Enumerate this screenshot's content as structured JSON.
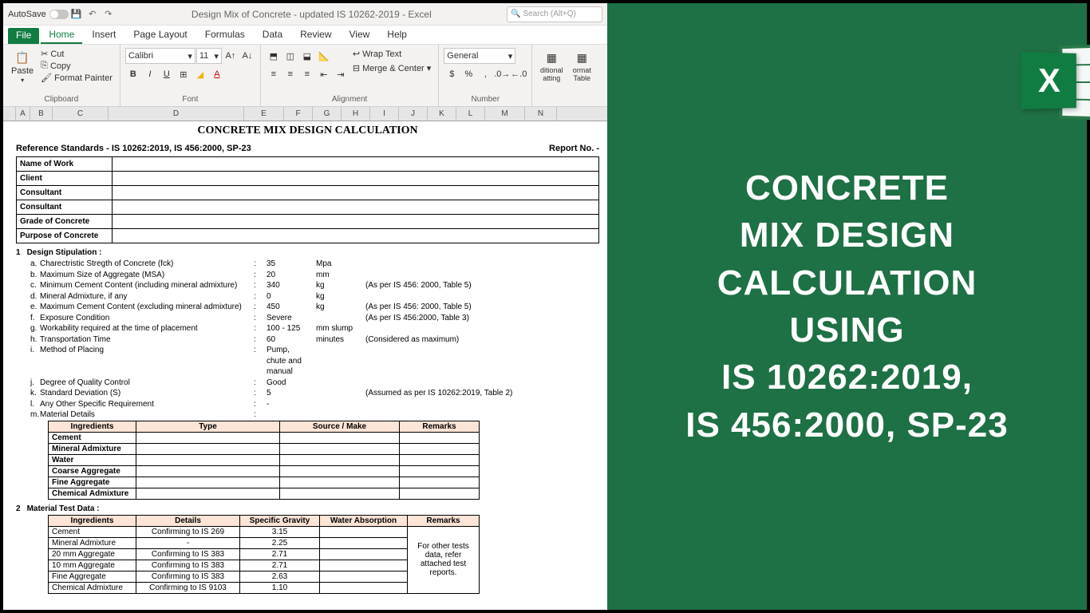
{
  "titlebar": {
    "autosave": "AutoSave",
    "title": "Design Mix of Concrete - updated IS 10262-2019  -  Excel",
    "search_placeholder": "Search (Alt+Q)"
  },
  "tabs": {
    "file": "File",
    "home": "Home",
    "insert": "Insert",
    "pagelayout": "Page Layout",
    "formulas": "Formulas",
    "data": "Data",
    "review": "Review",
    "view": "View",
    "help": "Help"
  },
  "ribbon": {
    "clipboard": {
      "label": "Clipboard",
      "paste": "Paste",
      "cut": "Cut",
      "copy": "Copy",
      "fmtpainter": "Format Painter"
    },
    "font": {
      "label": "Font",
      "name": "Calibri",
      "size": "11"
    },
    "alignment": {
      "label": "Alignment",
      "wrap": "Wrap Text",
      "merge": "Merge & Center"
    },
    "number": {
      "label": "Number",
      "format": "General"
    },
    "styles": {
      "cond": "ditional atting",
      "table": "ormat Table"
    }
  },
  "cols": [
    "A",
    "B",
    "C",
    "D",
    "E",
    "F",
    "G",
    "H",
    "I",
    "J",
    "K",
    "L",
    "M",
    "N"
  ],
  "doc": {
    "title": "CONCRETE MIX DESIGN CALCULATION",
    "ref": "Reference Standards - IS 10262:2019, IS 456:2000, SP-23",
    "report": "Report No. -",
    "header_rows": [
      "Name of Work",
      "Client",
      "Consultant",
      "Consultant",
      "Grade of Concrete",
      "Purpose of Concrete"
    ],
    "sec1_num": "1",
    "sec1": "Design Stipulation :",
    "stips": [
      {
        "l": "a.",
        "t": "Charectristic Stregth of Concrete (fck)",
        "v": "35",
        "u": "Mpa",
        "n": ""
      },
      {
        "l": "b.",
        "t": "Maximum Size of Aggregate (MSA)",
        "v": "20",
        "u": "mm",
        "n": ""
      },
      {
        "l": "c.",
        "t": "Minimum Cement Content (including mineral admixture)",
        "v": "340",
        "u": "kg",
        "n": "(As per IS 456: 2000, Table 5)"
      },
      {
        "l": "d.",
        "t": "Mineral Admixture, if any",
        "v": "0",
        "u": "kg",
        "n": ""
      },
      {
        "l": "e.",
        "t": "Maximum Cement Content (excluding mineral admixture)",
        "v": "450",
        "u": "kg",
        "n": "(As per IS 456: 2000, Table 5)"
      },
      {
        "l": "f.",
        "t": "Exposure Condition",
        "v": "Severe",
        "u": "",
        "n": "(As per IS 456:2000, Table 3)"
      },
      {
        "l": "g.",
        "t": "Workability required at the time of placement",
        "v": "100 - 125",
        "u": "mm slump",
        "n": ""
      },
      {
        "l": "h.",
        "t": "Transportation Time",
        "v": "60",
        "u": "minutes",
        "n": "(Considered as maximum)"
      },
      {
        "l": "i.",
        "t": "Method of Placing",
        "v": "Pump, chute and manual",
        "u": "",
        "n": ""
      },
      {
        "l": "j.",
        "t": "Degree of Quality Control",
        "v": "Good",
        "u": "",
        "n": ""
      },
      {
        "l": "k.",
        "t": "Standard Deviation (S)",
        "v": "5",
        "u": "",
        "n": "(Assumed as per IS 10262:2019, Table 2)"
      },
      {
        "l": "l.",
        "t": "Any Other Specific Requirement",
        "v": "-",
        "u": "",
        "n": ""
      },
      {
        "l": "m.",
        "t": "Material Details",
        "v": "",
        "u": "",
        "n": ""
      }
    ],
    "mat1_head": [
      "Ingredients",
      "Type",
      "Source / Make",
      "Remarks"
    ],
    "mat1_rows": [
      "Cement",
      "Mineral Admixture",
      "Water",
      "Coarse Aggregate",
      "Fine Aggregate",
      "Chemical Admixture"
    ],
    "sec2_num": "2",
    "sec2": "Material Test Data :",
    "mat2_head": [
      "Ingredients",
      "Details",
      "Specific Gravity",
      "Water Absorption",
      "Remarks"
    ],
    "mat2_rows": [
      {
        "i": "Cement",
        "d": "Confirming to IS 269",
        "sg": "3.15",
        "wa": ""
      },
      {
        "i": "Mineral Admixture",
        "d": "-",
        "sg": "2.25",
        "wa": ""
      },
      {
        "i": "20 mm Aggregate",
        "d": "Confirming to IS 383",
        "sg": "2.71",
        "wa": ""
      },
      {
        "i": "10 mm Aggregate",
        "d": "Confirming to IS 383",
        "sg": "2.71",
        "wa": ""
      },
      {
        "i": "Fine Aggregate",
        "d": "Confirming to IS 383",
        "sg": "2.63",
        "wa": ""
      },
      {
        "i": "Chemical Admixture",
        "d": "Confirming to IS 9103",
        "sg": "1.10",
        "wa": ""
      }
    ],
    "mat2_remark": "For other tests data, refer attached test reports."
  },
  "promo": {
    "l1": "CONCRETE",
    "l2": "MIX DESIGN",
    "l3": "CALCULATION",
    "l4": "USING",
    "l5": "IS 10262:2019,",
    "l6": "IS 456:2000, SP-23"
  }
}
